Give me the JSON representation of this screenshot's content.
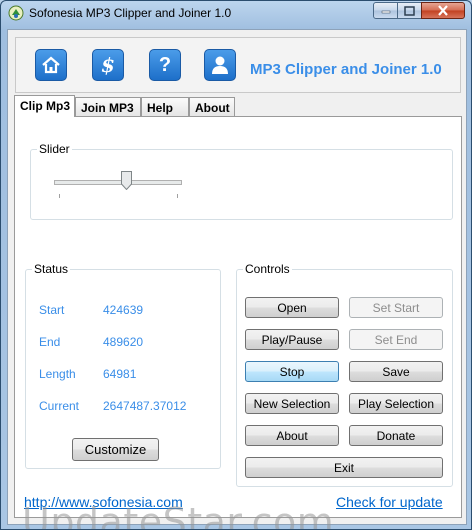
{
  "window": {
    "title": "Sofonesia MP3 Clipper and Joiner 1.0"
  },
  "toolbar": {
    "heading": "MP3 Clipper and Joiner 1.0",
    "buttons": [
      {
        "icon": "home-icon",
        "glyph": "⌂"
      },
      {
        "icon": "dollar-icon",
        "glyph": "$"
      },
      {
        "icon": "help-icon",
        "glyph": "?"
      },
      {
        "icon": "user-icon",
        "glyph": ""
      }
    ]
  },
  "tabs": [
    "Clip Mp3",
    "Join MP3",
    "Help",
    "About"
  ],
  "active_tab": "Clip Mp3",
  "slider": {
    "label": "Slider",
    "value_fraction": 0.57
  },
  "status": {
    "label": "Status",
    "rows": [
      {
        "name": "Start",
        "value": "424639"
      },
      {
        "name": "End",
        "value": "489620"
      },
      {
        "name": "Length",
        "value": "64981"
      },
      {
        "name": "Current",
        "value": "2647487.37012"
      }
    ],
    "customize": "Customize"
  },
  "controls": {
    "label": "Controls",
    "open": "Open",
    "set_start": "Set Start",
    "play_pause": "Play/Pause",
    "set_end": "Set End",
    "stop": "Stop",
    "save": "Save",
    "new_selection": "New Selection",
    "play_selection": "Play Selection",
    "about": "About",
    "donate": "Donate",
    "exit": "Exit"
  },
  "footer": {
    "website": "http://www.sofonesia.com",
    "update": "Check for update",
    "watermark": "UpdateStar.com"
  },
  "colors": {
    "accent": "#3a8ee8",
    "link": "#0066cc"
  }
}
